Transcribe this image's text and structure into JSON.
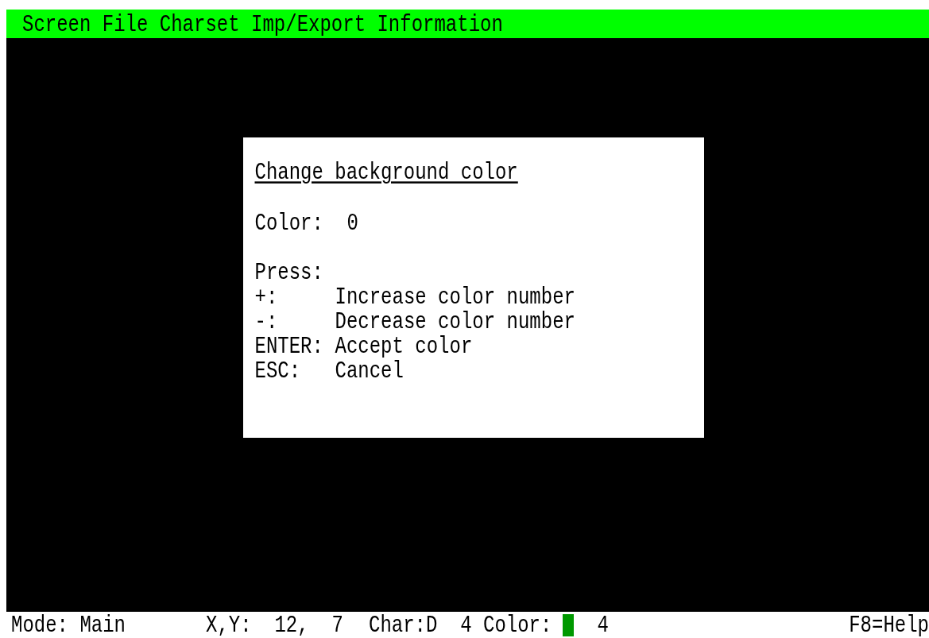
{
  "menu_bar": {
    "items": [
      "Screen",
      "File",
      "Charset",
      "Imp/Export",
      "Information"
    ]
  },
  "dialog": {
    "title": "Change background color",
    "color_label": "Color:",
    "color_value": "0",
    "press_label": "Press:",
    "keys": [
      {
        "key": "+:",
        "action": "Increase color number"
      },
      {
        "key": "-:",
        "action": "Decrease color number"
      },
      {
        "key": "ENTER:",
        "action": "Accept color"
      },
      {
        "key": "ESC:",
        "action": "Cancel"
      }
    ]
  },
  "status_bar": {
    "mode": "Mode: Main",
    "position": "X,Y:  12,  7",
    "char": "Char:D  4",
    "color_label": "Color:",
    "color": "#009900",
    "color_value": "4",
    "help": "F8=Help"
  }
}
